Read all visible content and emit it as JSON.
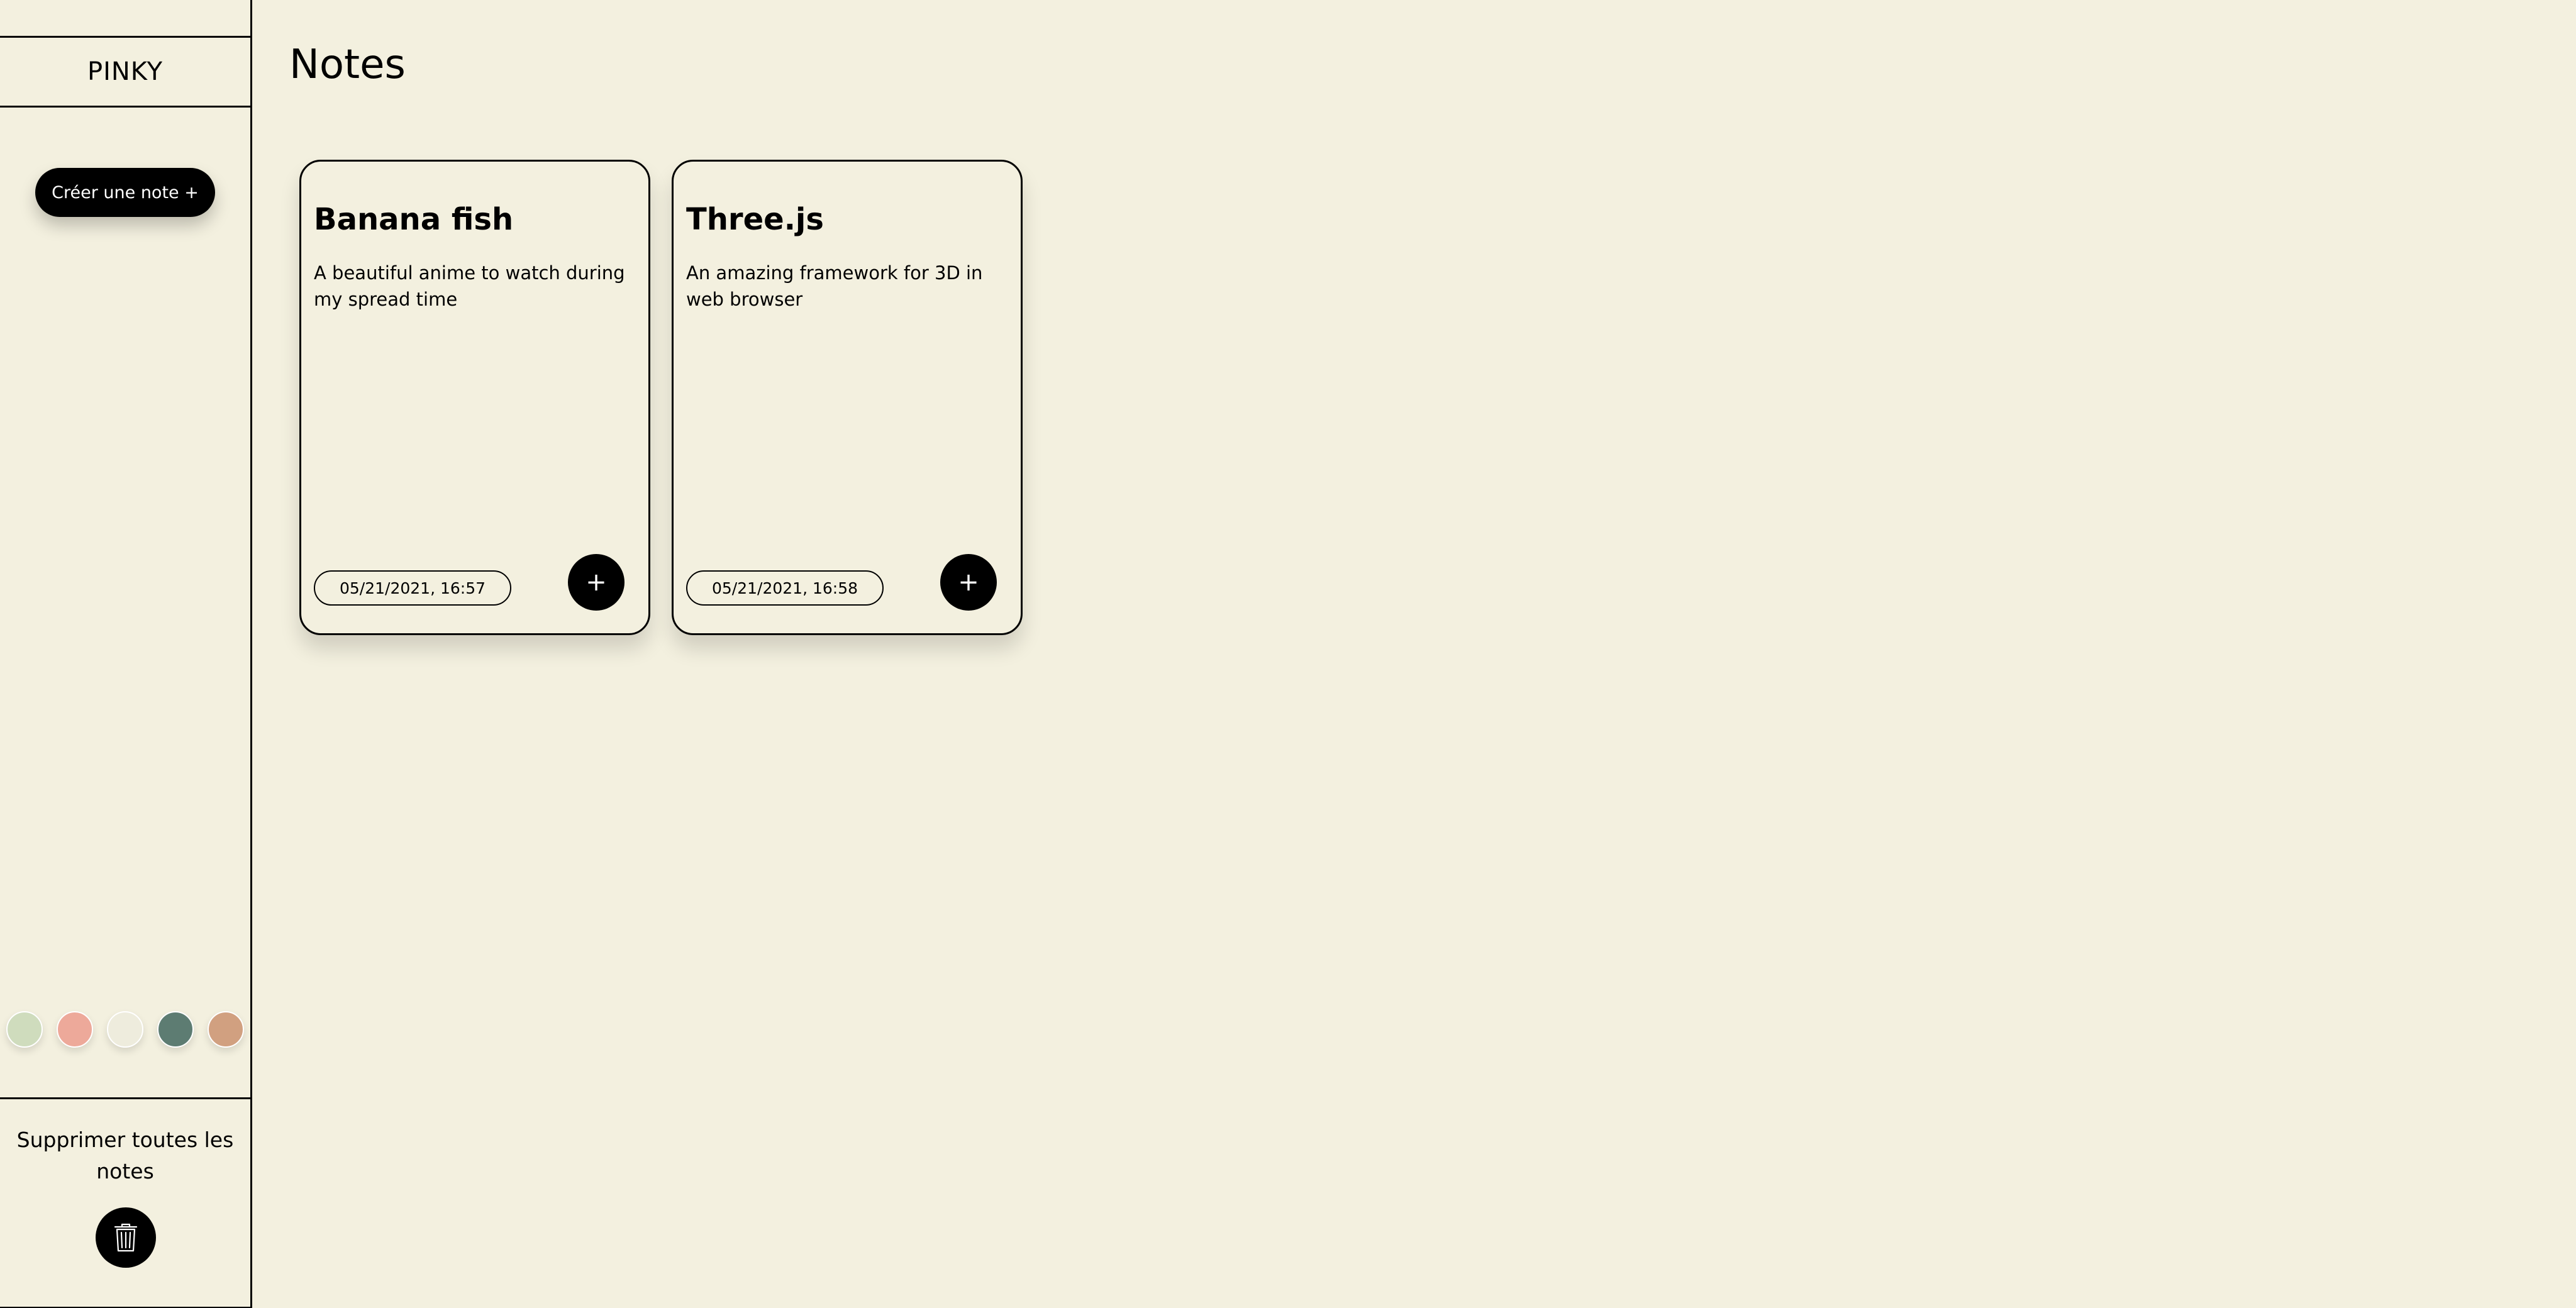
{
  "app": {
    "brand": "PINKY",
    "page_title": "Notes"
  },
  "sidebar": {
    "create_label": "Créer une note +",
    "swatches": [
      {
        "name": "sage",
        "color": "#cfdcbd"
      },
      {
        "name": "pink",
        "color": "#eda99a"
      },
      {
        "name": "cream",
        "color": "#eeecdd"
      },
      {
        "name": "teal",
        "color": "#5d7c72"
      },
      {
        "name": "tan",
        "color": "#d1a080"
      }
    ],
    "delete_all_label": "Supprimer toutes les notes",
    "trash_icon": "trash-icon"
  },
  "notes": [
    {
      "title": "Banana fish",
      "description": "A beautiful anime to watch during my spread time",
      "date": "05/21/2021, 16:57",
      "add_label": "+"
    },
    {
      "title": "Three.js",
      "description": "An amazing framework for 3D in web browser",
      "date": "05/21/2021, 16:58",
      "add_label": "+"
    }
  ],
  "colors": {
    "background": "#f3f0df",
    "accent": "#000000",
    "text": "#000000"
  }
}
